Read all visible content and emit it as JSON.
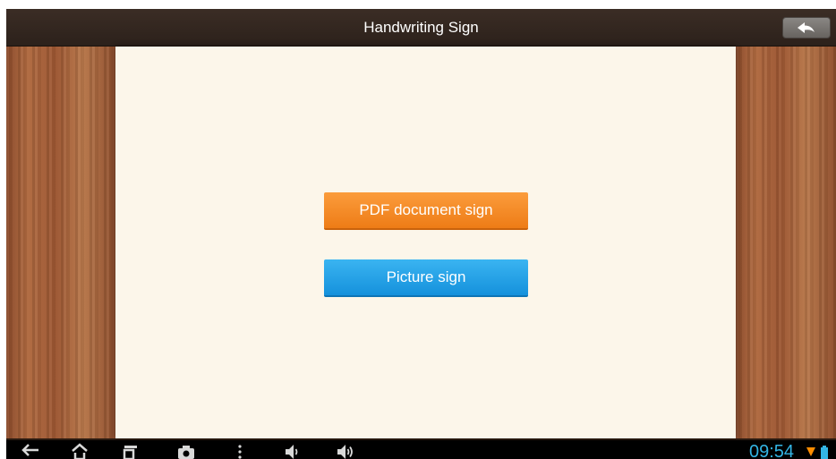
{
  "header": {
    "title": "Handwriting Sign",
    "back_icon": "back-arrow-icon"
  },
  "actions": {
    "pdf_sign_label": "PDF document sign",
    "picture_sign_label": "Picture sign"
  },
  "colors": {
    "pdf_button": "#f28a25",
    "picture_button": "#2aa6ea",
    "paper": "#fcf6ea",
    "titlebar": "#3b2d25",
    "clock": "#33b5e5"
  },
  "system_bar": {
    "nav_icons": [
      "back-icon",
      "home-icon",
      "recent-apps-icon",
      "camera-icon",
      "menu-icon",
      "volume-down-icon",
      "volume-up-icon"
    ],
    "status_icons": [
      "wifi-icon",
      "battery-icon"
    ],
    "time": "09:54"
  }
}
